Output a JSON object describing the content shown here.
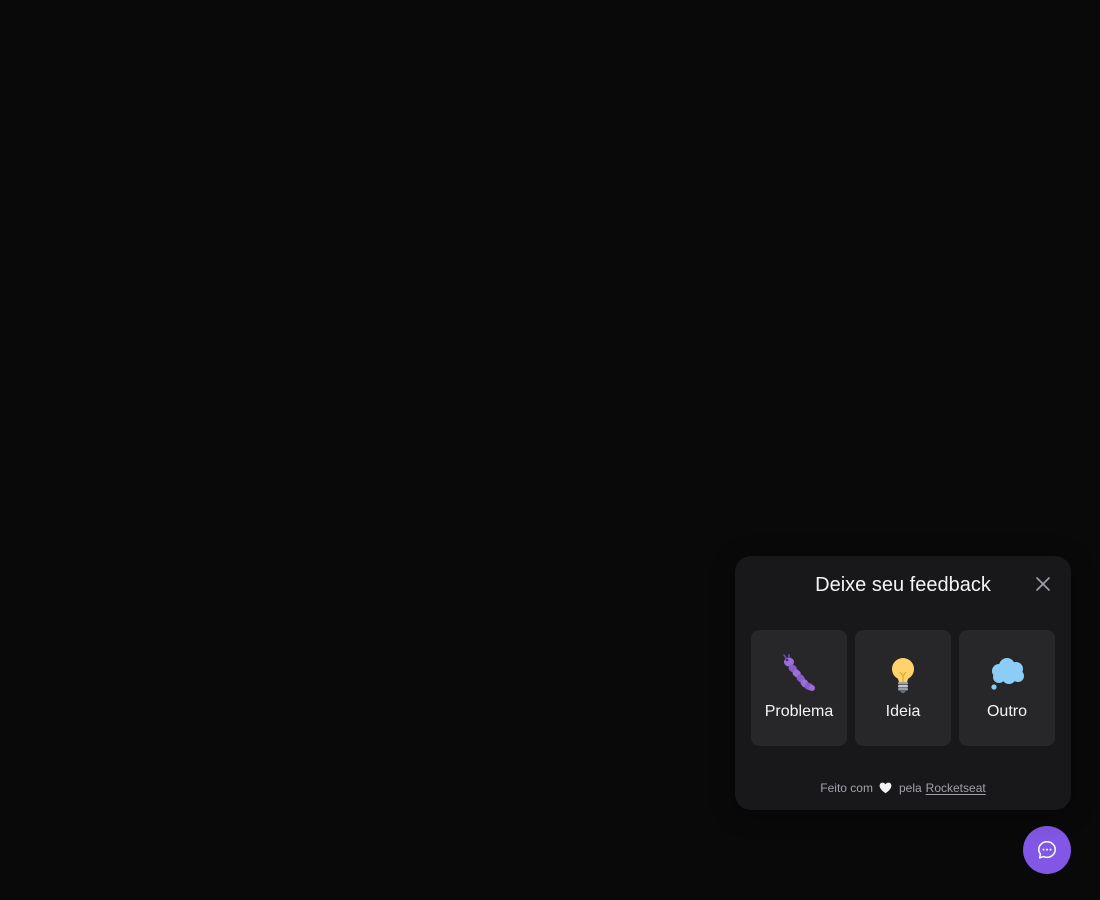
{
  "popover": {
    "title": "Deixe seu feedback",
    "close_icon": "close-icon"
  },
  "types": [
    {
      "label": "Problema",
      "icon": "bug-icon"
    },
    {
      "label": "Ideia",
      "icon": "idea-icon"
    },
    {
      "label": "Outro",
      "icon": "thought-icon"
    }
  ],
  "footer": {
    "prefix": "Feito com",
    "icon": "heart-icon",
    "middle": "pela",
    "link": "Rocketseat"
  },
  "fab": {
    "icon": "chat-icon"
  },
  "colors": {
    "background": "#09090a",
    "surface": "#18181b",
    "card": "#27272a",
    "brand": "#8257e5",
    "text": "#f4f4f5",
    "muted": "#a1a1aa"
  }
}
